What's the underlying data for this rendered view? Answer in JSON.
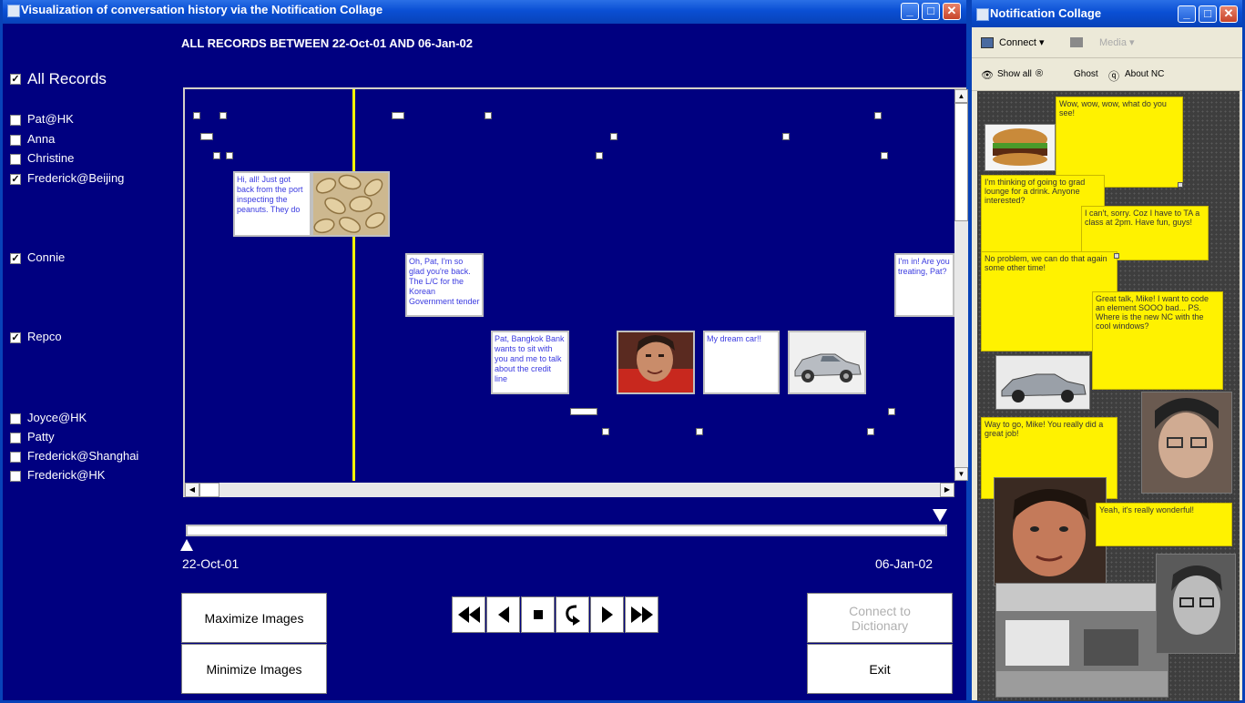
{
  "main_window": {
    "title": "Visualization of conversation history via the Notification Collage",
    "header": "ALL RECORDS BETWEEN 22-Oct-01 AND 06-Jan-02",
    "all_records": {
      "label": "All Records",
      "checked": true
    },
    "people": [
      {
        "label": "Pat@HK",
        "checked": false
      },
      {
        "label": "Anna",
        "checked": false
      },
      {
        "label": "Christine",
        "checked": false
      },
      {
        "label": "Frederick@Beijing",
        "checked": true
      },
      {
        "label": "Connie",
        "checked": true
      },
      {
        "label": "Repco",
        "checked": true
      },
      {
        "label": "Joyce@HK",
        "checked": false
      },
      {
        "label": "Patty",
        "checked": false
      },
      {
        "label": "Frederick@Shanghai",
        "checked": false
      },
      {
        "label": "Frederick@HK",
        "checked": false
      }
    ],
    "notes": {
      "frederick": "Hi, all! Just got back from the port inspecting the peanuts.  They do",
      "connie": "Oh, Pat, I'm so glad you're back.  The L/C for the Korean Government tender",
      "connie_right": "I'm in!  Are you treating, Pat?",
      "repco_bank": "Pat, Bangkok Bank wants to sit with you and me to talk about the credit line",
      "repco_car": "My dream car!!"
    },
    "range": {
      "start": "22-Oct-01",
      "end": "06-Jan-02",
      "start_handle": 0.0,
      "end_handle": 1.0
    },
    "buttons": {
      "maximize": "Maximize Images",
      "minimize": "Minimize Images",
      "connect": "Connect to Dictionary",
      "exit": "Exit"
    },
    "media_controls": [
      "rewind-icon",
      "step-back-icon",
      "stop-icon",
      "loop-icon",
      "play-icon",
      "fast-forward-icon"
    ]
  },
  "collage_window": {
    "title": "Notification Collage",
    "toolbar": {
      "connect": "Connect",
      "media": "Media",
      "show_all": "Show all",
      "ghost": "Ghost",
      "about": "About NC"
    },
    "posts": [
      "Wow, wow, wow, what do you see!",
      "I'm thinking of going to grad lounge for a drink. Anyone interested?",
      "I can't, sorry. Coz I have to TA a class at 2pm. Have fun, guys!",
      "No problem, we can do that again some other time!",
      "Great talk, Mike! I want to code an element SOOO bad... PS. Where is the new NC with the cool windows?",
      "Way to go, Mike!  You really did a great job!",
      "Yeah, it's really wonderful!"
    ]
  },
  "colors": {
    "background": "#000080",
    "timeline": "#ffff00",
    "titlebar": "#0a4fd4",
    "post": "#fff200"
  }
}
